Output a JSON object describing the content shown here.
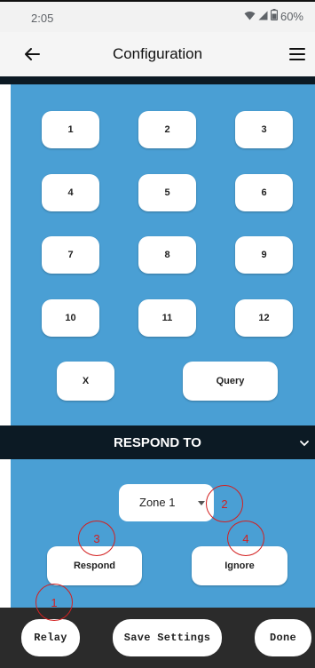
{
  "status_bar": {
    "time": "2:05",
    "battery": "60%"
  },
  "app_bar": {
    "title": "Configuration"
  },
  "keypad": {
    "keys": [
      "1",
      "2",
      "3",
      "4",
      "5",
      "6",
      "7",
      "8",
      "9",
      "10",
      "11",
      "12"
    ],
    "clear_label": "X",
    "query_label": "Query"
  },
  "respond_section": {
    "header": "RESPOND TO",
    "zone_select_value": "Zone 1",
    "respond_label": "Respond",
    "ignore_label": "Ignore"
  },
  "annotations": [
    "1",
    "2",
    "3",
    "4"
  ],
  "bottom_bar": {
    "relay_label": "Relay",
    "save_label": "Save Settings",
    "done_label": "Done"
  },
  "colors": {
    "panel_blue": "#4a9fd4",
    "dark_header": "#0c1a24",
    "annotation_red": "#d32020",
    "bottom_bar": "#2b2b2b"
  },
  "icons": {
    "wifi": "wifi-icon",
    "signal": "signal-icon",
    "battery": "battery-icon",
    "back": "back-arrow-icon",
    "menu": "hamburger-menu-icon",
    "chevron": "chevron-down-icon"
  }
}
